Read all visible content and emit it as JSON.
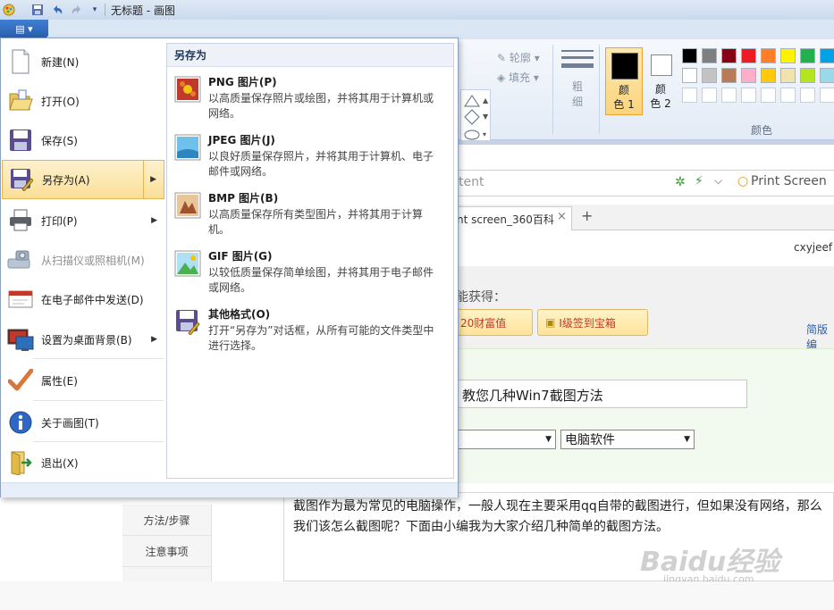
{
  "window": {
    "title": "无标题 - 画图"
  },
  "ribbon": {
    "outline_label": "轮廓",
    "fill_label": "填充",
    "size_label_a": "粗",
    "size_label_b": "细",
    "color1_label_a": "颜",
    "color1_label_b": "色 1",
    "color2_label_a": "颜",
    "color2_label_b": "色 2",
    "colors_group": "颜色",
    "palette_row1": [
      "#000000",
      "#7f7f7f",
      "#880015",
      "#ed1c24",
      "#ff7f27",
      "#fff200",
      "#22b14c",
      "#00a2e8"
    ],
    "palette_row2": [
      "#ffffff",
      "#c3c3c3",
      "#b97a57",
      "#ffaec9",
      "#ffc90e",
      "#efe4b0",
      "#b5e61d",
      "#99d9ea"
    ]
  },
  "file_menu": {
    "items": [
      {
        "label": "新建(N)"
      },
      {
        "label": "打开(O)"
      },
      {
        "label": "保存(S)"
      },
      {
        "label": "另存为(A)"
      },
      {
        "label": "打印(P)"
      },
      {
        "label": "从扫描仪或照相机(M)"
      },
      {
        "label": "在电子邮件中发送(D)"
      },
      {
        "label": "设置为桌面背景(B)"
      },
      {
        "label": "属性(E)"
      },
      {
        "label": "关于画图(T)"
      },
      {
        "label": "退出(X)"
      }
    ],
    "submenu": {
      "header": "另存为",
      "items": [
        {
          "title": "PNG 图片(P)",
          "desc": "以高质量保存照片或绘图，并将其用于计算机或网络。"
        },
        {
          "title": "JPEG 图片(J)",
          "desc": "以良好质量保存照片，并将其用于计算机、电子邮件或网络。"
        },
        {
          "title": "BMP 图片(B)",
          "desc": "以高质量保存所有类型图片，并将其用于计算机。"
        },
        {
          "title": "GIF 图片(G)",
          "desc": "以较低质量保存简单绘图，并将其用于电子邮件或网络。"
        },
        {
          "title": "其他格式(O)",
          "desc": "打开“另存为”对话框，从所有可能的文件类型中进行选择。"
        }
      ]
    }
  },
  "background_page": {
    "addr_text": "tent",
    "search_text": "Print Screen",
    "tab_label": "nt screen_360百科",
    "user": "cxyjeef",
    "prompt": "能获得：",
    "btn1": "20财富值",
    "btn2": "Ⅰ级签到宝箱",
    "side_link": "简版编",
    "article_title": "教您几种Win7截图方法",
    "category": "电脑软件",
    "nav_items": [
      "方法/步骤",
      "注意事项"
    ],
    "article_text": "截图作为最为常见的电脑操作，一般人现在主要采用qq自带的截图进行，但如果没有网络，那么我们该怎么截图呢？下面由小编我为大家介绍几种简单的截图方法。",
    "watermark": "Baidu经验",
    "watermark_url": "jingyan.baidu.com"
  }
}
